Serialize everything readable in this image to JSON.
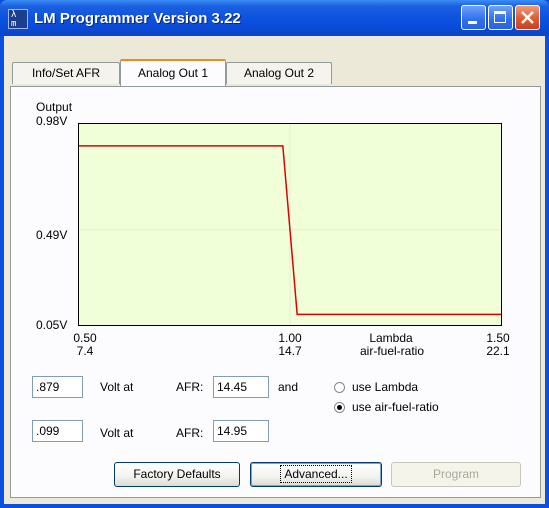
{
  "window": {
    "title": "LM Programmer Version 3.22",
    "app_icon_glyph": "λ\nm"
  },
  "tabs": [
    {
      "label": "Info/Set AFR",
      "selected": false
    },
    {
      "label": "Analog Out 1",
      "selected": true
    },
    {
      "label": "Analog Out 2",
      "selected": false
    }
  ],
  "chart_data": {
    "type": "line",
    "ylabel": "Output",
    "y_ticks": [
      "0.98V",
      "0.49V",
      "0.05V"
    ],
    "ylim": [
      0.05,
      0.98
    ],
    "xlim": [
      0.5,
      1.5
    ],
    "x_ticks": [
      {
        "top": "0.50",
        "bottom": "7.4"
      },
      {
        "top": "1.00",
        "bottom": "14.7"
      },
      {
        "top": "1.50",
        "bottom": "22.1"
      }
    ],
    "x_axis_label_top": "Lambda",
    "x_axis_label_bottom": "air-fuel-ratio",
    "grid": true,
    "line_color": "#e00000",
    "background_color": "#f1ffd9",
    "series": [
      {
        "x": [
          0.5,
          0.983,
          1.017,
          1.5
        ],
        "y": [
          0.879,
          0.879,
          0.099,
          0.099
        ]
      }
    ]
  },
  "form": {
    "row1": {
      "volt_value": ".879",
      "volt_at_label": "Volt at",
      "afr_label": "AFR:",
      "afr_value": "14.45",
      "and_label": "and"
    },
    "row2": {
      "volt_value": ".099",
      "volt_at_label": "Volt at",
      "afr_label": "AFR:",
      "afr_value": "14.95"
    },
    "radio_lambda": {
      "label": "use Lambda",
      "selected": false
    },
    "radio_afr": {
      "label": "use air-fuel-ratio",
      "selected": true
    }
  },
  "buttons": {
    "factory_defaults": "Factory Defaults",
    "advanced": "Advanced...",
    "program": "Program"
  },
  "colors": {
    "titlebar": "#0a4fdf",
    "client": "#ece9d8",
    "plot_background": "#f1ffd9",
    "line": "#e00000"
  }
}
